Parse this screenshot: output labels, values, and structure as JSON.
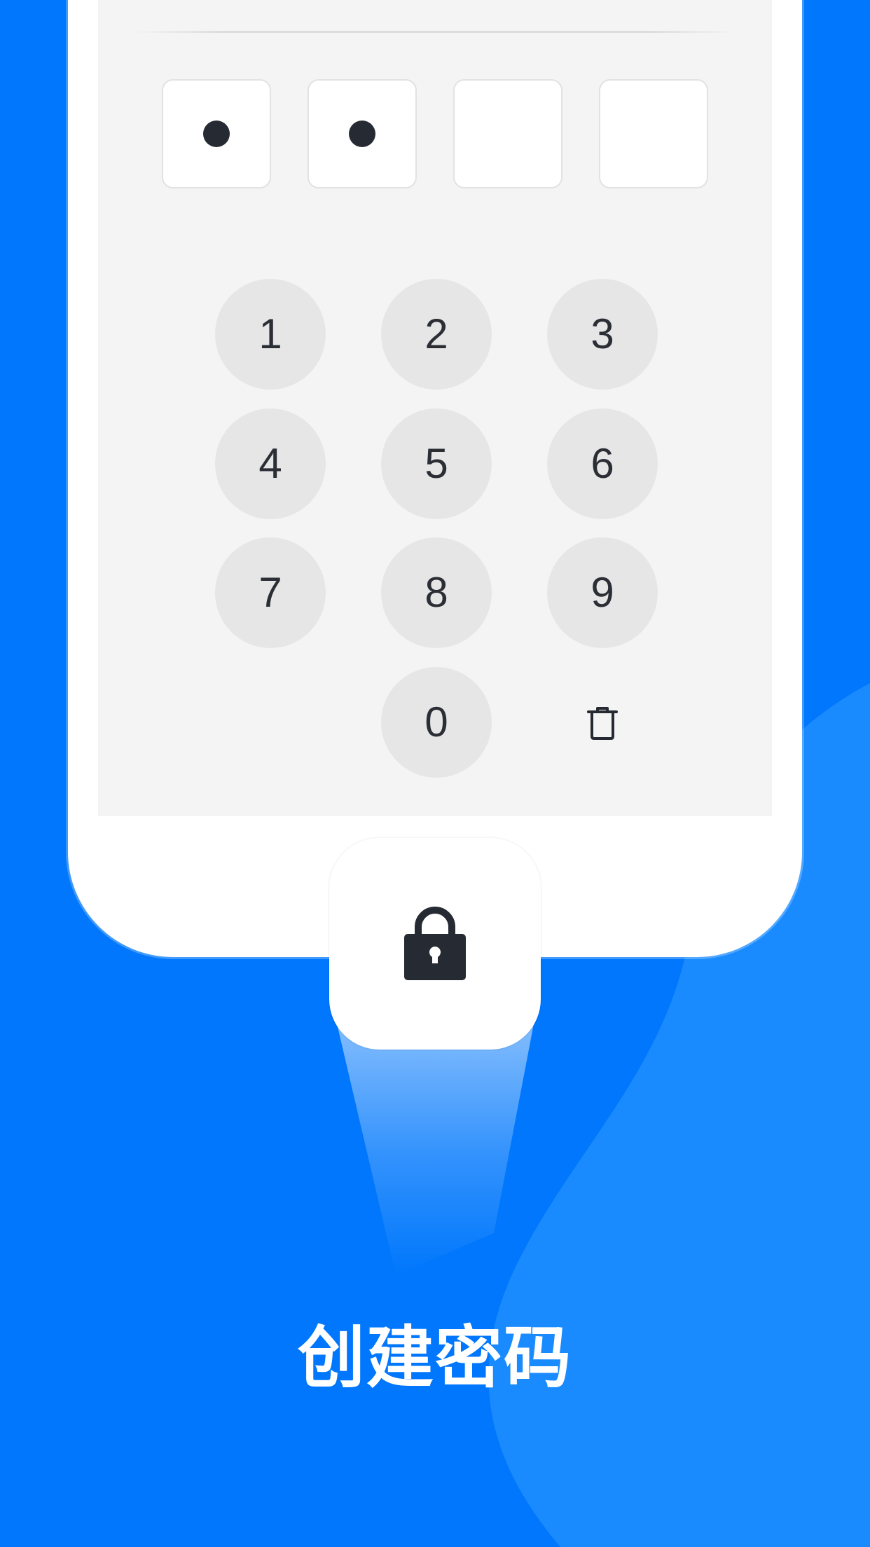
{
  "theme": {
    "background": "#0077FC",
    "wave": "#1A8BFF",
    "phone": "#FFFFFF",
    "screen": "#F4F4F4",
    "key_bg": "#E6E6E6",
    "dot": "#262A33"
  },
  "pin": {
    "length": 4,
    "filled": 2
  },
  "keypad": {
    "keys": [
      "1",
      "2",
      "3",
      "4",
      "5",
      "6",
      "7",
      "8",
      "9",
      "0"
    ],
    "delete_icon": "trash-icon"
  },
  "lock": {
    "icon": "lock-icon"
  },
  "caption": "创建密码"
}
